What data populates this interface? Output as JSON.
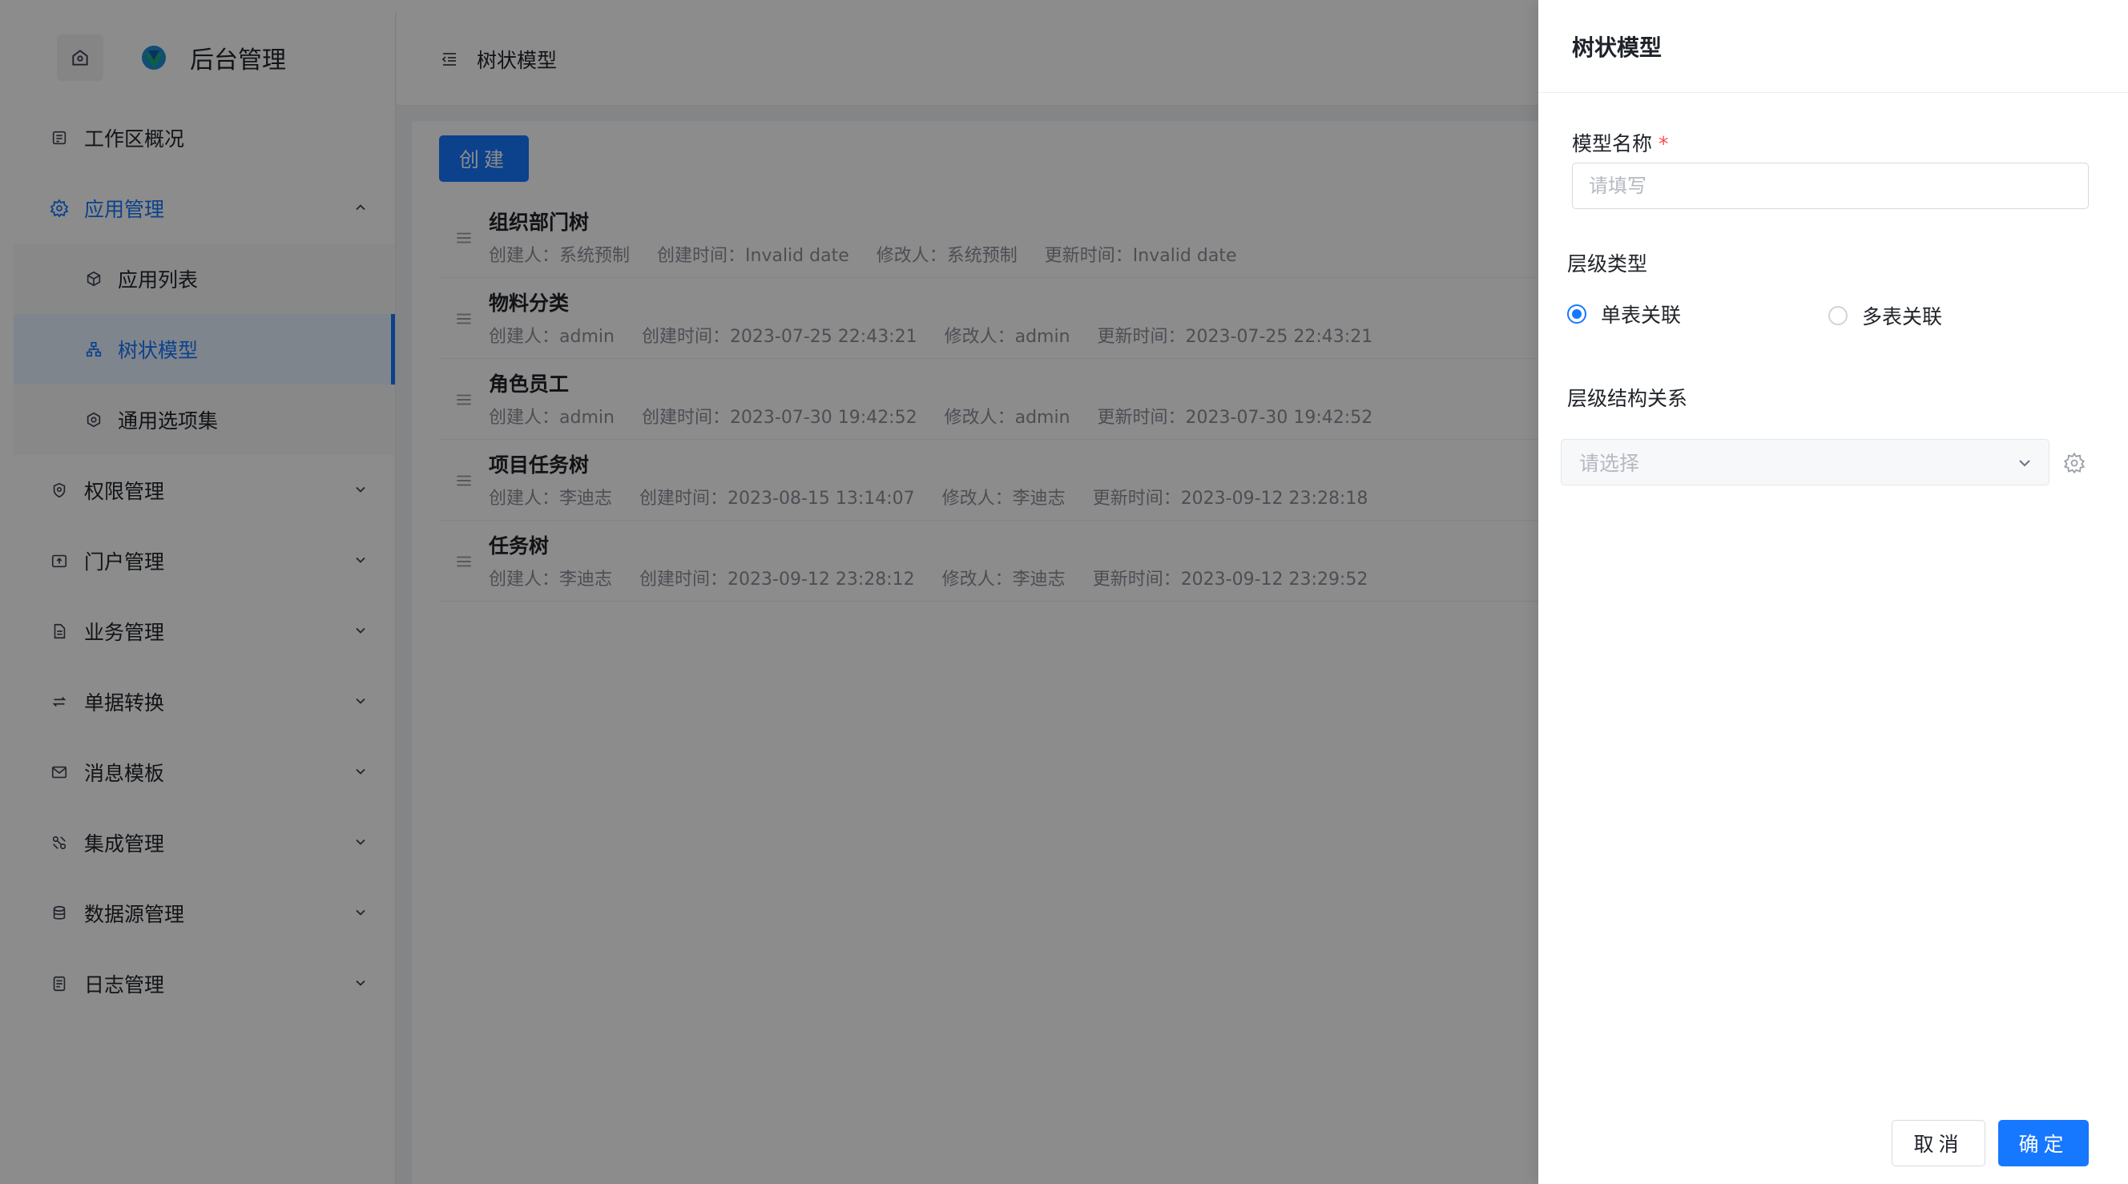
{
  "app": {
    "title": "后台管理"
  },
  "sidebar": {
    "items": [
      {
        "label": "工作区概况",
        "icon": "dashboard-icon"
      },
      {
        "label": "应用管理",
        "icon": "gear-icon",
        "expanded": true,
        "children": [
          {
            "label": "应用列表",
            "icon": "cube-icon"
          },
          {
            "label": "树状模型",
            "icon": "tree-icon",
            "selected": true
          },
          {
            "label": "通用选项集",
            "icon": "hexagon-icon"
          }
        ]
      },
      {
        "label": "权限管理",
        "icon": "shield-icon"
      },
      {
        "label": "门户管理",
        "icon": "upload-icon"
      },
      {
        "label": "业务管理",
        "icon": "file-icon"
      },
      {
        "label": "单据转换",
        "icon": "swap-icon"
      },
      {
        "label": "消息模板",
        "icon": "mail-icon"
      },
      {
        "label": "集成管理",
        "icon": "integration-icon"
      },
      {
        "label": "数据源管理",
        "icon": "database-icon"
      },
      {
        "label": "日志管理",
        "icon": "log-icon"
      }
    ]
  },
  "header": {
    "breadcrumb": "树状模型"
  },
  "main": {
    "create_label": "创建",
    "rows": [
      {
        "name": "组织部门树",
        "creator": "创建人：系统预制",
        "created": "创建时间：Invalid date",
        "modifier": "修改人：系统预制",
        "updated": "更新时间：Invalid date"
      },
      {
        "name": "物料分类",
        "creator": "创建人：admin",
        "created": "创建时间：2023-07-25 22:43:21",
        "modifier": "修改人：admin",
        "updated": "更新时间：2023-07-25 22:43:21"
      },
      {
        "name": "角色员工",
        "creator": "创建人：admin",
        "created": "创建时间：2023-07-30 19:42:52",
        "modifier": "修改人：admin",
        "updated": "更新时间：2023-07-30 19:42:52"
      },
      {
        "name": "项目任务树",
        "creator": "创建人：李迪志",
        "created": "创建时间：2023-08-15 13:14:07",
        "modifier": "修改人：李迪志",
        "updated": "更新时间：2023-09-12 23:28:18"
      },
      {
        "name": "任务树",
        "creator": "创建人：李迪志",
        "created": "创建时间：2023-09-12 23:28:12",
        "modifier": "修改人：李迪志",
        "updated": "更新时间：2023-09-12 23:29:52"
      }
    ]
  },
  "drawer": {
    "title": "树状模型",
    "name_label": "模型名称",
    "required_mark": "*",
    "name_placeholder": "请填写",
    "name_value": "",
    "level_type_label": "层级类型",
    "level_options": [
      {
        "label": "单表关联",
        "checked": true
      },
      {
        "label": "多表关联",
        "checked": false
      }
    ],
    "relation_label": "层级结构关系",
    "relation_placeholder": "请选择",
    "cancel_label": "取消",
    "ok_label": "确定"
  },
  "colors": {
    "primary": "#1677ff",
    "danger": "#ff4d4f",
    "overlay": "rgba(0,0,0,0.45)"
  }
}
